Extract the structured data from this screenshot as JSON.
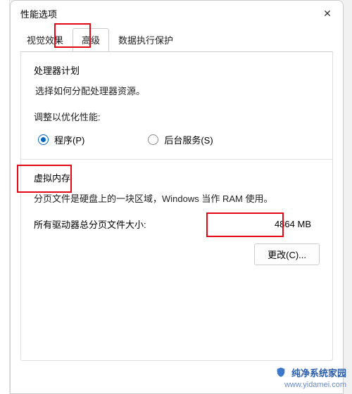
{
  "dialog": {
    "title": "性能选项",
    "close_icon": "✕"
  },
  "tabs": {
    "visual": "视觉效果",
    "advanced": "高级",
    "dep": "数据执行保护"
  },
  "processor": {
    "title": "处理器计划",
    "desc": "选择如何分配处理器资源。",
    "adjust_label": "调整以优化性能:",
    "option_programs": "程序(P)",
    "option_services": "后台服务(S)"
  },
  "virtual_memory": {
    "title": "虚拟内存",
    "desc": "分页文件是硬盘上的一块区域，Windows 当作 RAM 使用。",
    "total_label": "所有驱动器总分页文件大小:",
    "total_value": "4864 MB",
    "change_button": "更改(C)..."
  },
  "watermark": {
    "line1": "纯净系统家园",
    "line2": "www.yidamei.com"
  }
}
